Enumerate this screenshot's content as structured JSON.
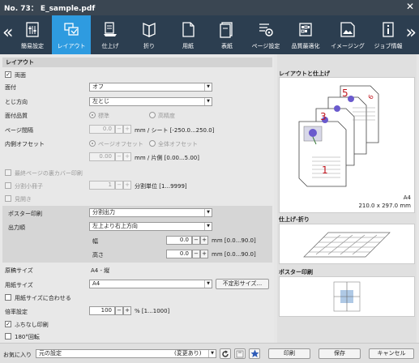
{
  "window": {
    "title": "No. 73： E_sample.pdf",
    "close_glyph": "✕"
  },
  "toolbar": {
    "prev": "«",
    "next": "»",
    "tabs": [
      {
        "label": "簡易設定",
        "icon": "simple-settings-icon"
      },
      {
        "label": "レイアウト",
        "icon": "layout-icon",
        "active": true
      },
      {
        "label": "仕上げ",
        "icon": "finishing-icon"
      },
      {
        "label": "折り",
        "icon": "folding-icon"
      },
      {
        "label": "用紙",
        "icon": "paper-icon"
      },
      {
        "label": "表紙",
        "icon": "cover-icon"
      },
      {
        "label": "ページ設定",
        "icon": "page-settings-icon"
      },
      {
        "label": "品質最適化",
        "icon": "quality-icon"
      },
      {
        "label": "イメージング",
        "icon": "imaging-icon"
      },
      {
        "label": "ジョブ情報",
        "icon": "job-info-icon"
      }
    ]
  },
  "layout": {
    "section_title": "レイアウト",
    "duplex_label": "両面",
    "imposition": {
      "label": "面付",
      "value": "オフ"
    },
    "binding": {
      "label": "とじ方向",
      "value": "左とじ"
    },
    "imposition_quality": {
      "label": "面付品質",
      "opt1": "標準",
      "opt2": "高精度"
    },
    "page_gap": {
      "label": "ページ間隔",
      "value": "0.0",
      "unit": "mm / シート [-250.0...250.0]"
    },
    "inner_offset": {
      "label": "内側オフセット",
      "opt1": "ページオフセット",
      "opt2": "全体オフセット",
      "value": "0.00",
      "unit": "mm / 片側 [0.00...5.00]"
    },
    "last_page_back_cover": "最終ページの裏カバー印刷",
    "split_booklet": {
      "label": "分割小冊子",
      "value": "1",
      "unit": "分割単位 [1...9999]"
    },
    "spread": "見開き",
    "poster": {
      "label": "ポスター印刷",
      "value": "分割出力",
      "order_label": "出力順",
      "order_value": "左上より右上方向",
      "width_label": "幅",
      "width_value": "0.0",
      "width_unit": "mm [0.0...90.0]",
      "height_label": "高さ",
      "height_value": "0.0",
      "height_unit": "mm [0.0...90.0]"
    },
    "original_size": {
      "label": "原稿サイズ",
      "value": "A4 - 縦"
    },
    "paper_size": {
      "label": "用紙サイズ",
      "value": "A4",
      "custom_button": "不定形サイズ..."
    },
    "fit_to_paper": "用紙サイズに合わせる",
    "scale": {
      "label": "倍率設定",
      "value": "100",
      "unit": "% [1...1000]"
    },
    "borderless": "ふちなし印刷",
    "rotate180": "180°回転"
  },
  "preview": {
    "layout_title": "レイアウトと仕上げ",
    "paper": "A4",
    "dims": "210.0 x 297.0 mm",
    "page_numbers": [
      "1",
      "3",
      "5",
      "6"
    ],
    "fold_title": "仕上げ-折り",
    "poster_title": "ポスター印刷"
  },
  "bottom": {
    "favorites_label": "お気に入り",
    "favorites_value": "元の設定",
    "favorites_state": "(変更あり)",
    "print": "印刷",
    "save": "保存",
    "cancel": "キャンセル"
  },
  "colors": {
    "accent": "#2e9be0",
    "toolbar": "#2c3e50",
    "titlebar": "#3a4652",
    "page_number": "#c0141c"
  }
}
